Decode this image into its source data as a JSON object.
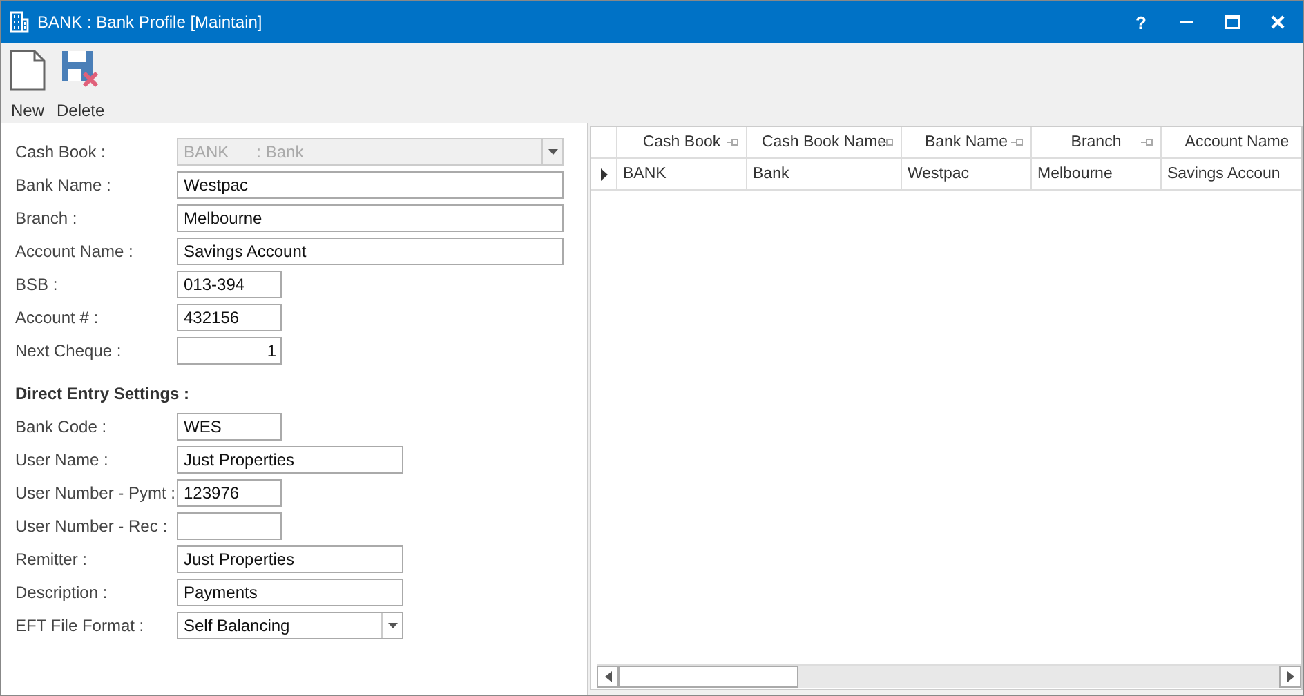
{
  "window": {
    "title": "BANK : Bank Profile [Maintain]",
    "help": "?"
  },
  "toolbar": [
    {
      "kind": "new",
      "label": "New"
    },
    {
      "kind": "delete",
      "label": "Delete"
    }
  ],
  "form": {
    "fields": [
      {
        "label": "Cash Book :",
        "kind": "combo",
        "value": "BANK      : Bank",
        "disabled": true
      },
      {
        "label": "Bank Name :",
        "kind": "text",
        "value": "Westpac",
        "disabled": false
      },
      {
        "label": "Branch :",
        "kind": "text",
        "value": "Melbourne",
        "disabled": false
      },
      {
        "label": "Account Name :",
        "kind": "text",
        "value": "Savings Account",
        "disabled": false
      },
      {
        "label": "BSB :",
        "kind": "text",
        "value": "013-394",
        "disabled": false
      },
      {
        "label": "Account # :",
        "kind": "text",
        "value": "432156",
        "disabled": false
      },
      {
        "label": "Next Cheque :",
        "kind": "number",
        "value": "1",
        "disabled": false
      }
    ],
    "section_title": "Direct Entry Settings :",
    "direct_entry": [
      {
        "label": "Bank Code :",
        "kind": "text",
        "value": "WES",
        "disabled": false
      },
      {
        "label": "User Name :",
        "kind": "text",
        "value": "Just Properties",
        "disabled": false
      },
      {
        "label": "User Number - Pymt :",
        "kind": "text",
        "value": "123976",
        "disabled": false
      },
      {
        "label": "User Number - Rec :",
        "kind": "text",
        "disabled": false
      },
      {
        "label": "Remitter :",
        "kind": "text",
        "value": "Just Properties",
        "disabled": false
      },
      {
        "label": "Description :",
        "kind": "text",
        "value": "Payments",
        "disabled": false
      },
      {
        "label": "EFT File Format :",
        "kind": "combo",
        "value": "Self Balancing",
        "disabled": false
      }
    ]
  },
  "table": {
    "columns": [
      "Cash Book",
      "Cash Book Name",
      "Bank Name",
      "Branch",
      "Account Name"
    ],
    "rows": [
      {
        "selected": true,
        "cells": [
          "BANK",
          "Bank",
          "Westpac",
          "Melbourne",
          "Savings Accoun"
        ]
      }
    ]
  }
}
